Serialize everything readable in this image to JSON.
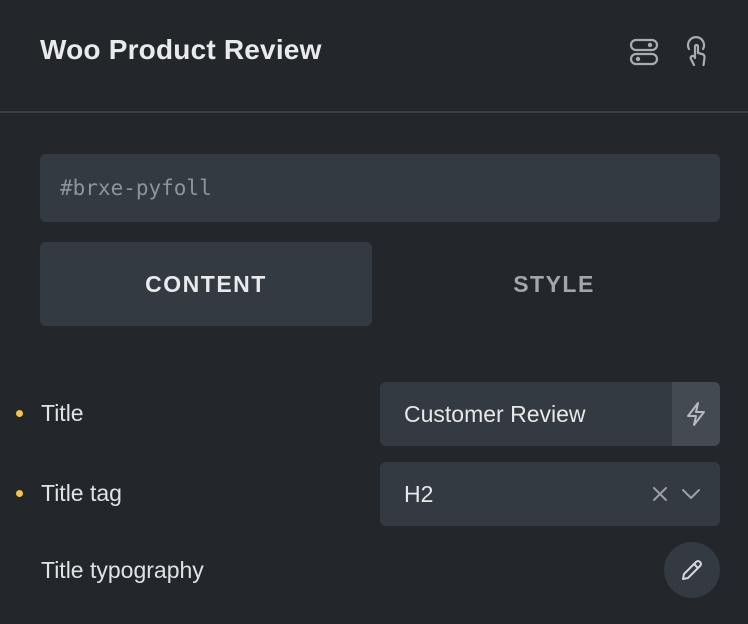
{
  "panel": {
    "title": "Woo Product Review"
  },
  "header_icons": [
    "toggle-icon",
    "pointer-icon"
  ],
  "element_id": {
    "placeholder": "#brxe-pyfoll"
  },
  "tabs": [
    {
      "label": "CONTENT",
      "active": true
    },
    {
      "label": "STYLE",
      "active": false
    }
  ],
  "controls": {
    "title": {
      "label": "Title",
      "value": "Customer Review",
      "modified": true
    },
    "title_tag": {
      "label": "Title tag",
      "value": "H2",
      "modified": true
    },
    "title_typography": {
      "label": "Title typography"
    }
  },
  "colors": {
    "background": "#23272c",
    "surface": "#343a41",
    "modified_dot": "#f2c14e",
    "text": "#e6e8ea",
    "muted": "#8d949b"
  }
}
